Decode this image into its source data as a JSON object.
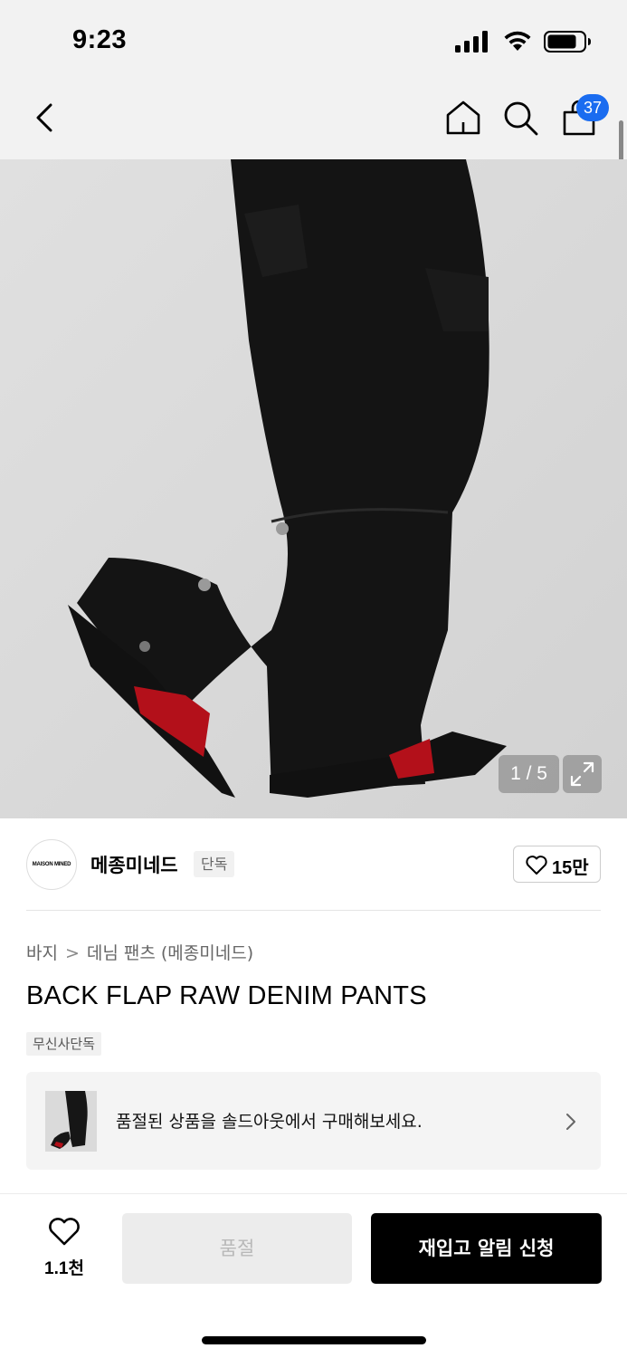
{
  "status_bar": {
    "time": "9:23"
  },
  "header": {
    "back_icon": "chevron-left-icon",
    "home_icon": "home-icon",
    "search_icon": "search-icon",
    "cart_icon": "shopping-bag-icon",
    "cart_count": "37",
    "badge_color": "#1a6cf0"
  },
  "gallery": {
    "counter": "1 / 5",
    "expand_icon": "expand-icon"
  },
  "brand": {
    "logo_text": "MAISON MINED",
    "name": "메종미네드",
    "tag": "단독",
    "like_count": "15만"
  },
  "breadcrumb": {
    "category": "바지",
    "subcategory": "데님 팬츠 (메종미네드)"
  },
  "product": {
    "title": "BACK FLAP RAW DENIM PANTS",
    "badge": "무신사단독"
  },
  "soldout_banner": {
    "text": "품절된 상품을 솔드아웃에서 구매해보세요.",
    "chevron_icon": "chevron-right-icon"
  },
  "bottom_bar": {
    "wish_icon": "heart-icon",
    "wish_count": "1.1천",
    "soldout_label": "품절",
    "restock_label": "재입고 알림 신청",
    "primary_color": "#000000"
  }
}
